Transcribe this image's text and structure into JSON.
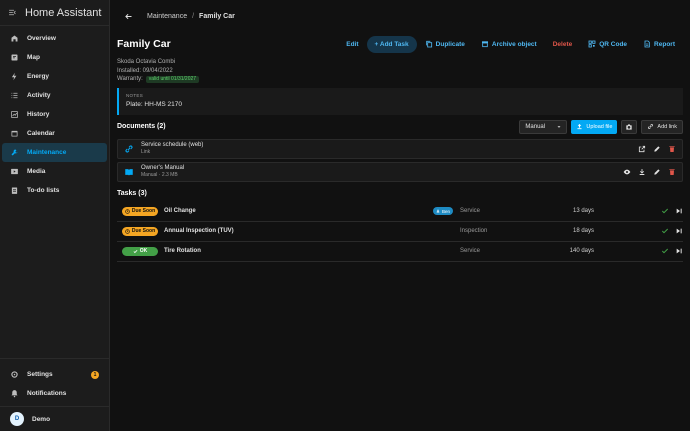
{
  "app": {
    "title": "Home Assistant"
  },
  "sidebar": {
    "items": [
      {
        "label": "Overview",
        "icon": "view-dashboard-icon"
      },
      {
        "label": "Map",
        "icon": "map-icon"
      },
      {
        "label": "Energy",
        "icon": "lightning-icon"
      },
      {
        "label": "Activity",
        "icon": "list-icon"
      },
      {
        "label": "History",
        "icon": "chart-icon"
      },
      {
        "label": "Calendar",
        "icon": "calendar-icon"
      },
      {
        "label": "Maintenance",
        "icon": "wrench-icon",
        "active": true
      },
      {
        "label": "Media",
        "icon": "media-icon"
      },
      {
        "label": "To-do lists",
        "icon": "clipboard-icon"
      }
    ],
    "settings": "Settings",
    "settings_badge": "1",
    "notifications": "Notifications",
    "user": {
      "initial": "D",
      "name": "Demo"
    }
  },
  "breadcrumb": {
    "parent": "Maintenance",
    "separator": "/",
    "current": "Family Car"
  },
  "page": {
    "title": "Family Car",
    "model": "Skoda Octavia Combi",
    "installed": "Installed: 09/04/2022",
    "warranty_label": "Warranty:",
    "warranty_badge": "valid until 01/31/2027"
  },
  "actions": {
    "edit": "Edit",
    "add_task": "+ Add Task",
    "duplicate": "Duplicate",
    "archive": "Archive object",
    "delete": "Delete",
    "qr": "QR Code",
    "report": "Report"
  },
  "notes": {
    "label": "NOTES",
    "text": "Plate: HH-MS 2170"
  },
  "documents": {
    "heading": "Documents (2)",
    "select_value": "Manual",
    "upload_label": "Upload file",
    "add_link_label": "Add link",
    "items": [
      {
        "name": "Service schedule (web)",
        "sub": "Link"
      },
      {
        "name": "Owner's Manual",
        "sub": "Manual · 2.3 MB"
      }
    ]
  },
  "tasks": {
    "heading": "Tasks (3)",
    "items": [
      {
        "status": "Due Soon",
        "name": "Oil Change",
        "tag": "Ben",
        "type": "Service",
        "due": "13 days"
      },
      {
        "status": "Due Soon",
        "name": "Annual Inspection (TUV)",
        "tag": "",
        "type": "Inspection",
        "due": "18 days"
      },
      {
        "status": "OK",
        "name": "Tire Rotation",
        "tag": "",
        "type": "Service",
        "due": "140 days"
      }
    ]
  },
  "colors": {
    "accent": "#03a9f4",
    "due": "#f5a623",
    "ok": "#43a047",
    "danger": "#e0564a"
  }
}
